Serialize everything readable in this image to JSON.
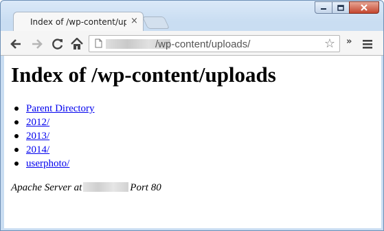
{
  "browser": {
    "tab_title": "Index of /wp-content/uploads/",
    "tab_close": "×",
    "address_path": "/wp-content/uploads/",
    "extensions_chevron": "»",
    "bookmark_star": "☆"
  },
  "page": {
    "heading": "Index of /wp-content/uploads",
    "links": [
      {
        "label": "Parent Directory"
      },
      {
        "label": "2012/"
      },
      {
        "label": "2013/"
      },
      {
        "label": "2014/"
      },
      {
        "label": "userphoto/"
      }
    ],
    "server_prefix": "Apache Server at",
    "server_suffix": "Port 80"
  },
  "icons": [
    "back-arrow-icon",
    "forward-arrow-icon",
    "reload-icon",
    "home-icon",
    "page-icon",
    "star-icon",
    "chrome-menu-icon",
    "minimize-icon",
    "maximize-icon",
    "close-icon"
  ],
  "colors": {
    "link": "#0000ee",
    "window_frame": "#c9ddf2",
    "close_button": "#c5462f"
  }
}
